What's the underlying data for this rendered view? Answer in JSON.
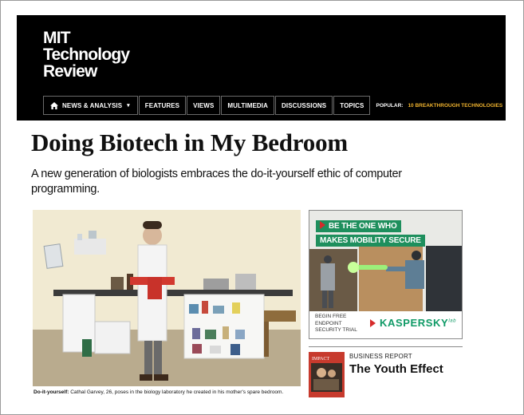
{
  "logo": {
    "line1": "MIT",
    "line2": "Technology",
    "line3": "Review"
  },
  "nav": {
    "main_label": "NEWS & ANALYSIS",
    "items": [
      {
        "label": "FEATURES"
      },
      {
        "label": "VIEWS"
      },
      {
        "label": "MULTIMEDIA"
      },
      {
        "label": "DISCUSSIONS"
      },
      {
        "label": "TOPICS"
      }
    ],
    "popular_label": "POPULAR:",
    "popular_link": "10 BREAKTHROUGH TECHNOLOGIES"
  },
  "article": {
    "headline": "Doing Biotech in My Bedroom",
    "dek": "A new generation of biologists embraces the do-it-yourself ethic of computer programming.",
    "caption_lead": "Do-it-yourself:",
    "caption_text": " Cathal Garvey, 26, poses in the biology laboratory he created in his mother's spare bedroom."
  },
  "ad": {
    "line1": "BE THE ONE WHO",
    "line2": "MAKES MOBILITY SECURE",
    "cta_line1": "BEGIN FREE",
    "cta_line2": "ENDPOINT",
    "cta_line3": "SECURITY TRIAL",
    "brand": "KASPERSKY",
    "brand_suffix": "lab",
    "accent_color": "#1e8f5d",
    "arrow_color": "#d62b2b"
  },
  "report": {
    "cover_text": "IMPACT",
    "kicker": "BUSINESS REPORT",
    "title": "The Youth Effect"
  },
  "colors": {
    "masthead_bg": "#000000",
    "popular_link": "#f0b32e",
    "cover_red": "#c73a2d"
  }
}
